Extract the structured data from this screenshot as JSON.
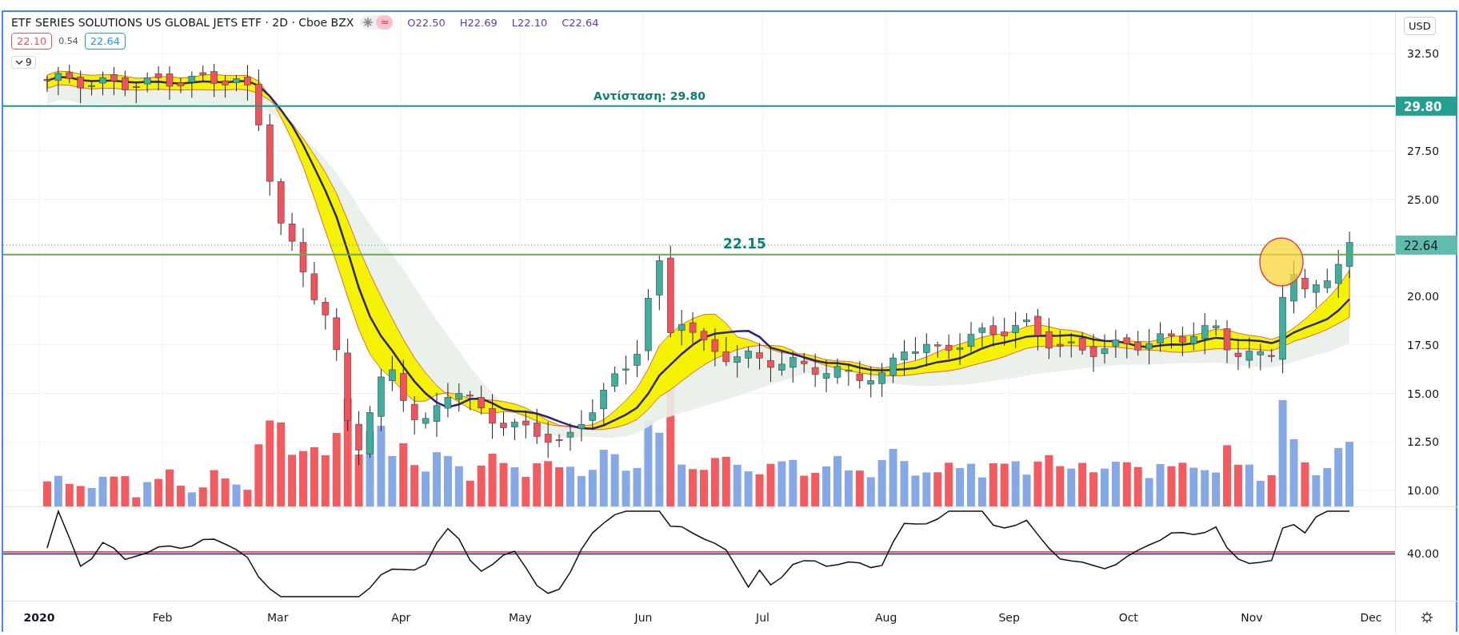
{
  "legend": {
    "title": "ETF SERIES SOLUTIONS US GLOBAL JETS ETF · 2D · Cboe BZX",
    "flag": "≈",
    "ohlc": [
      "O22.50",
      "H22.69",
      "L22.10",
      "C22.64"
    ],
    "bid": "22.10",
    "spread": "0.54",
    "ask": "22.64",
    "indicators_count": "9"
  },
  "currency": "USD",
  "price_axis": [
    "32.50",
    "27.50",
    "25.00",
    "20.00",
    "17.50",
    "15.00",
    "12.50",
    "10.00"
  ],
  "lines": [
    {
      "kind": "resistance",
      "label": "Αντίσταση: 29.80",
      "tag": "29.80"
    },
    {
      "kind": "support",
      "label": "22.15"
    }
  ],
  "last_price": "22.64",
  "rsi_axis": "40.00",
  "time_axis": [
    "2020",
    "Feb",
    "Mar",
    "Apr",
    "May",
    "Jun",
    "Jul",
    "Aug",
    "Sep",
    "Oct",
    "Nov",
    "Dec"
  ]
}
